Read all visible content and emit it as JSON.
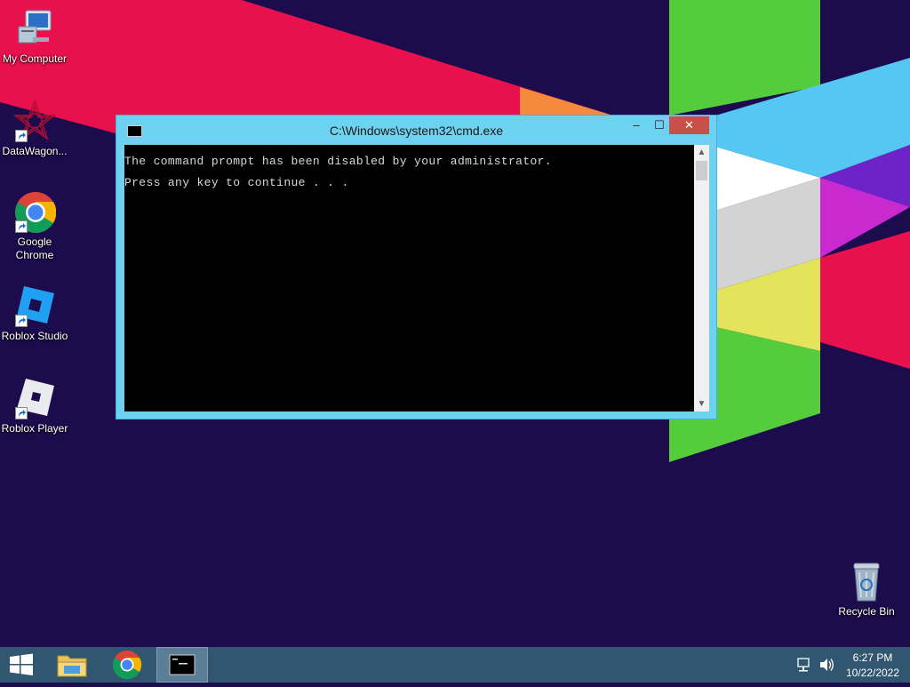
{
  "desktop": {
    "icons": [
      {
        "label": "My Computer",
        "icon": "my-computer-icon"
      },
      {
        "label": "DataWagon...",
        "icon": "datawagon-icon"
      },
      {
        "label": "Google\nChrome",
        "icon": "chrome-icon"
      },
      {
        "label": "Roblox Studio",
        "icon": "roblox-studio-icon"
      },
      {
        "label": "Roblox Player",
        "icon": "roblox-player-icon"
      },
      {
        "label": "Recycle Bin",
        "icon": "recycle-bin-icon"
      }
    ]
  },
  "window": {
    "title": "C:\\Windows\\system32\\cmd.exe",
    "lines": [
      "The command prompt has been disabled by your administrator.",
      "Press any key to continue . . ."
    ],
    "buttons": {
      "minimize": "–",
      "maximize": "☐",
      "close": "✕"
    }
  },
  "taskbar": {
    "start": "start-windows-icon",
    "pinned": [
      "file-explorer-icon",
      "chrome-icon",
      "cmd-icon"
    ],
    "tray": [
      "network-icon",
      "volume-icon"
    ],
    "time": "6:27 PM",
    "date": "10/22/2022"
  },
  "colors": {
    "wallpaper_bg": "#1c0b4d",
    "taskbar": "#31566f",
    "window_frame": "#6cd2f0",
    "close_button": "#c7504a"
  }
}
